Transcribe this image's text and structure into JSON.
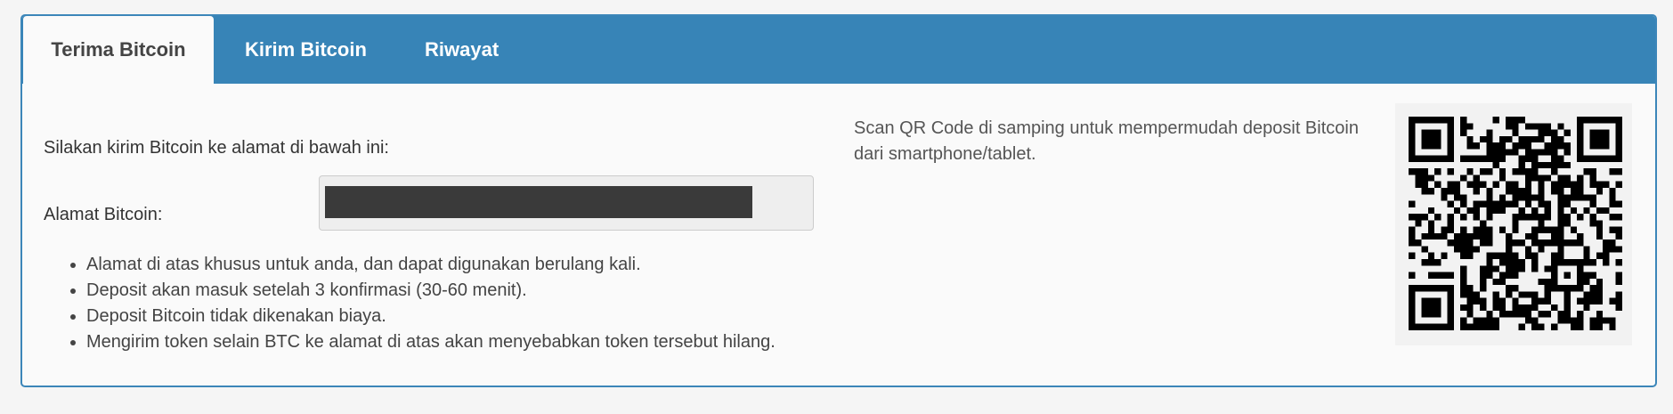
{
  "tabs": [
    {
      "label": "Terima Bitcoin",
      "active": true
    },
    {
      "label": "Kirim Bitcoin",
      "active": false
    },
    {
      "label": "Riwayat",
      "active": false
    }
  ],
  "receive": {
    "instruction": "Silakan kirim Bitcoin ke alamat di bawah ini:",
    "address_label": "Alamat Bitcoin:",
    "notes": [
      "Alamat di atas khusus untuk anda, dan dapat digunakan berulang kali.",
      "Deposit akan masuk setelah 3 konfirmasi (30-60 menit).",
      "Deposit Bitcoin tidak dikenakan biaya.",
      "Mengirim token selain BTC ke alamat di atas akan menyebabkan token tersebut hilang."
    ],
    "qr_hint": "Scan QR Code di samping untuk mempermudah deposit Bitcoin dari smartphone/tablet."
  },
  "colors": {
    "accent": "#3784b7",
    "panel_border": "#3c86b9",
    "background": "#f5f5f5"
  }
}
